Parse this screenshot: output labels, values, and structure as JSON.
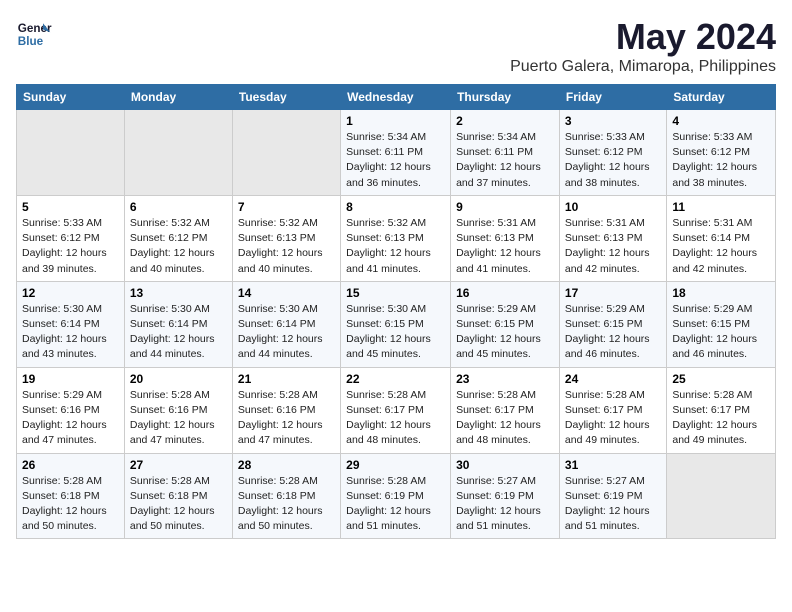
{
  "logo": {
    "line1": "General",
    "line2": "Blue"
  },
  "title": "May 2024",
  "subtitle": "Puerto Galera, Mimaropa, Philippines",
  "weekdays": [
    "Sunday",
    "Monday",
    "Tuesday",
    "Wednesday",
    "Thursday",
    "Friday",
    "Saturday"
  ],
  "weeks": [
    [
      {
        "day": "",
        "info": ""
      },
      {
        "day": "",
        "info": ""
      },
      {
        "day": "",
        "info": ""
      },
      {
        "day": "1",
        "info": "Sunrise: 5:34 AM\nSunset: 6:11 PM\nDaylight: 12 hours\nand 36 minutes."
      },
      {
        "day": "2",
        "info": "Sunrise: 5:34 AM\nSunset: 6:11 PM\nDaylight: 12 hours\nand 37 minutes."
      },
      {
        "day": "3",
        "info": "Sunrise: 5:33 AM\nSunset: 6:12 PM\nDaylight: 12 hours\nand 38 minutes."
      },
      {
        "day": "4",
        "info": "Sunrise: 5:33 AM\nSunset: 6:12 PM\nDaylight: 12 hours\nand 38 minutes."
      }
    ],
    [
      {
        "day": "5",
        "info": "Sunrise: 5:33 AM\nSunset: 6:12 PM\nDaylight: 12 hours\nand 39 minutes."
      },
      {
        "day": "6",
        "info": "Sunrise: 5:32 AM\nSunset: 6:12 PM\nDaylight: 12 hours\nand 40 minutes."
      },
      {
        "day": "7",
        "info": "Sunrise: 5:32 AM\nSunset: 6:13 PM\nDaylight: 12 hours\nand 40 minutes."
      },
      {
        "day": "8",
        "info": "Sunrise: 5:32 AM\nSunset: 6:13 PM\nDaylight: 12 hours\nand 41 minutes."
      },
      {
        "day": "9",
        "info": "Sunrise: 5:31 AM\nSunset: 6:13 PM\nDaylight: 12 hours\nand 41 minutes."
      },
      {
        "day": "10",
        "info": "Sunrise: 5:31 AM\nSunset: 6:13 PM\nDaylight: 12 hours\nand 42 minutes."
      },
      {
        "day": "11",
        "info": "Sunrise: 5:31 AM\nSunset: 6:14 PM\nDaylight: 12 hours\nand 42 minutes."
      }
    ],
    [
      {
        "day": "12",
        "info": "Sunrise: 5:30 AM\nSunset: 6:14 PM\nDaylight: 12 hours\nand 43 minutes."
      },
      {
        "day": "13",
        "info": "Sunrise: 5:30 AM\nSunset: 6:14 PM\nDaylight: 12 hours\nand 44 minutes."
      },
      {
        "day": "14",
        "info": "Sunrise: 5:30 AM\nSunset: 6:14 PM\nDaylight: 12 hours\nand 44 minutes."
      },
      {
        "day": "15",
        "info": "Sunrise: 5:30 AM\nSunset: 6:15 PM\nDaylight: 12 hours\nand 45 minutes."
      },
      {
        "day": "16",
        "info": "Sunrise: 5:29 AM\nSunset: 6:15 PM\nDaylight: 12 hours\nand 45 minutes."
      },
      {
        "day": "17",
        "info": "Sunrise: 5:29 AM\nSunset: 6:15 PM\nDaylight: 12 hours\nand 46 minutes."
      },
      {
        "day": "18",
        "info": "Sunrise: 5:29 AM\nSunset: 6:15 PM\nDaylight: 12 hours\nand 46 minutes."
      }
    ],
    [
      {
        "day": "19",
        "info": "Sunrise: 5:29 AM\nSunset: 6:16 PM\nDaylight: 12 hours\nand 47 minutes."
      },
      {
        "day": "20",
        "info": "Sunrise: 5:28 AM\nSunset: 6:16 PM\nDaylight: 12 hours\nand 47 minutes."
      },
      {
        "day": "21",
        "info": "Sunrise: 5:28 AM\nSunset: 6:16 PM\nDaylight: 12 hours\nand 47 minutes."
      },
      {
        "day": "22",
        "info": "Sunrise: 5:28 AM\nSunset: 6:17 PM\nDaylight: 12 hours\nand 48 minutes."
      },
      {
        "day": "23",
        "info": "Sunrise: 5:28 AM\nSunset: 6:17 PM\nDaylight: 12 hours\nand 48 minutes."
      },
      {
        "day": "24",
        "info": "Sunrise: 5:28 AM\nSunset: 6:17 PM\nDaylight: 12 hours\nand 49 minutes."
      },
      {
        "day": "25",
        "info": "Sunrise: 5:28 AM\nSunset: 6:17 PM\nDaylight: 12 hours\nand 49 minutes."
      }
    ],
    [
      {
        "day": "26",
        "info": "Sunrise: 5:28 AM\nSunset: 6:18 PM\nDaylight: 12 hours\nand 50 minutes."
      },
      {
        "day": "27",
        "info": "Sunrise: 5:28 AM\nSunset: 6:18 PM\nDaylight: 12 hours\nand 50 minutes."
      },
      {
        "day": "28",
        "info": "Sunrise: 5:28 AM\nSunset: 6:18 PM\nDaylight: 12 hours\nand 50 minutes."
      },
      {
        "day": "29",
        "info": "Sunrise: 5:28 AM\nSunset: 6:19 PM\nDaylight: 12 hours\nand 51 minutes."
      },
      {
        "day": "30",
        "info": "Sunrise: 5:27 AM\nSunset: 6:19 PM\nDaylight: 12 hours\nand 51 minutes."
      },
      {
        "day": "31",
        "info": "Sunrise: 5:27 AM\nSunset: 6:19 PM\nDaylight: 12 hours\nand 51 minutes."
      },
      {
        "day": "",
        "info": ""
      }
    ]
  ]
}
